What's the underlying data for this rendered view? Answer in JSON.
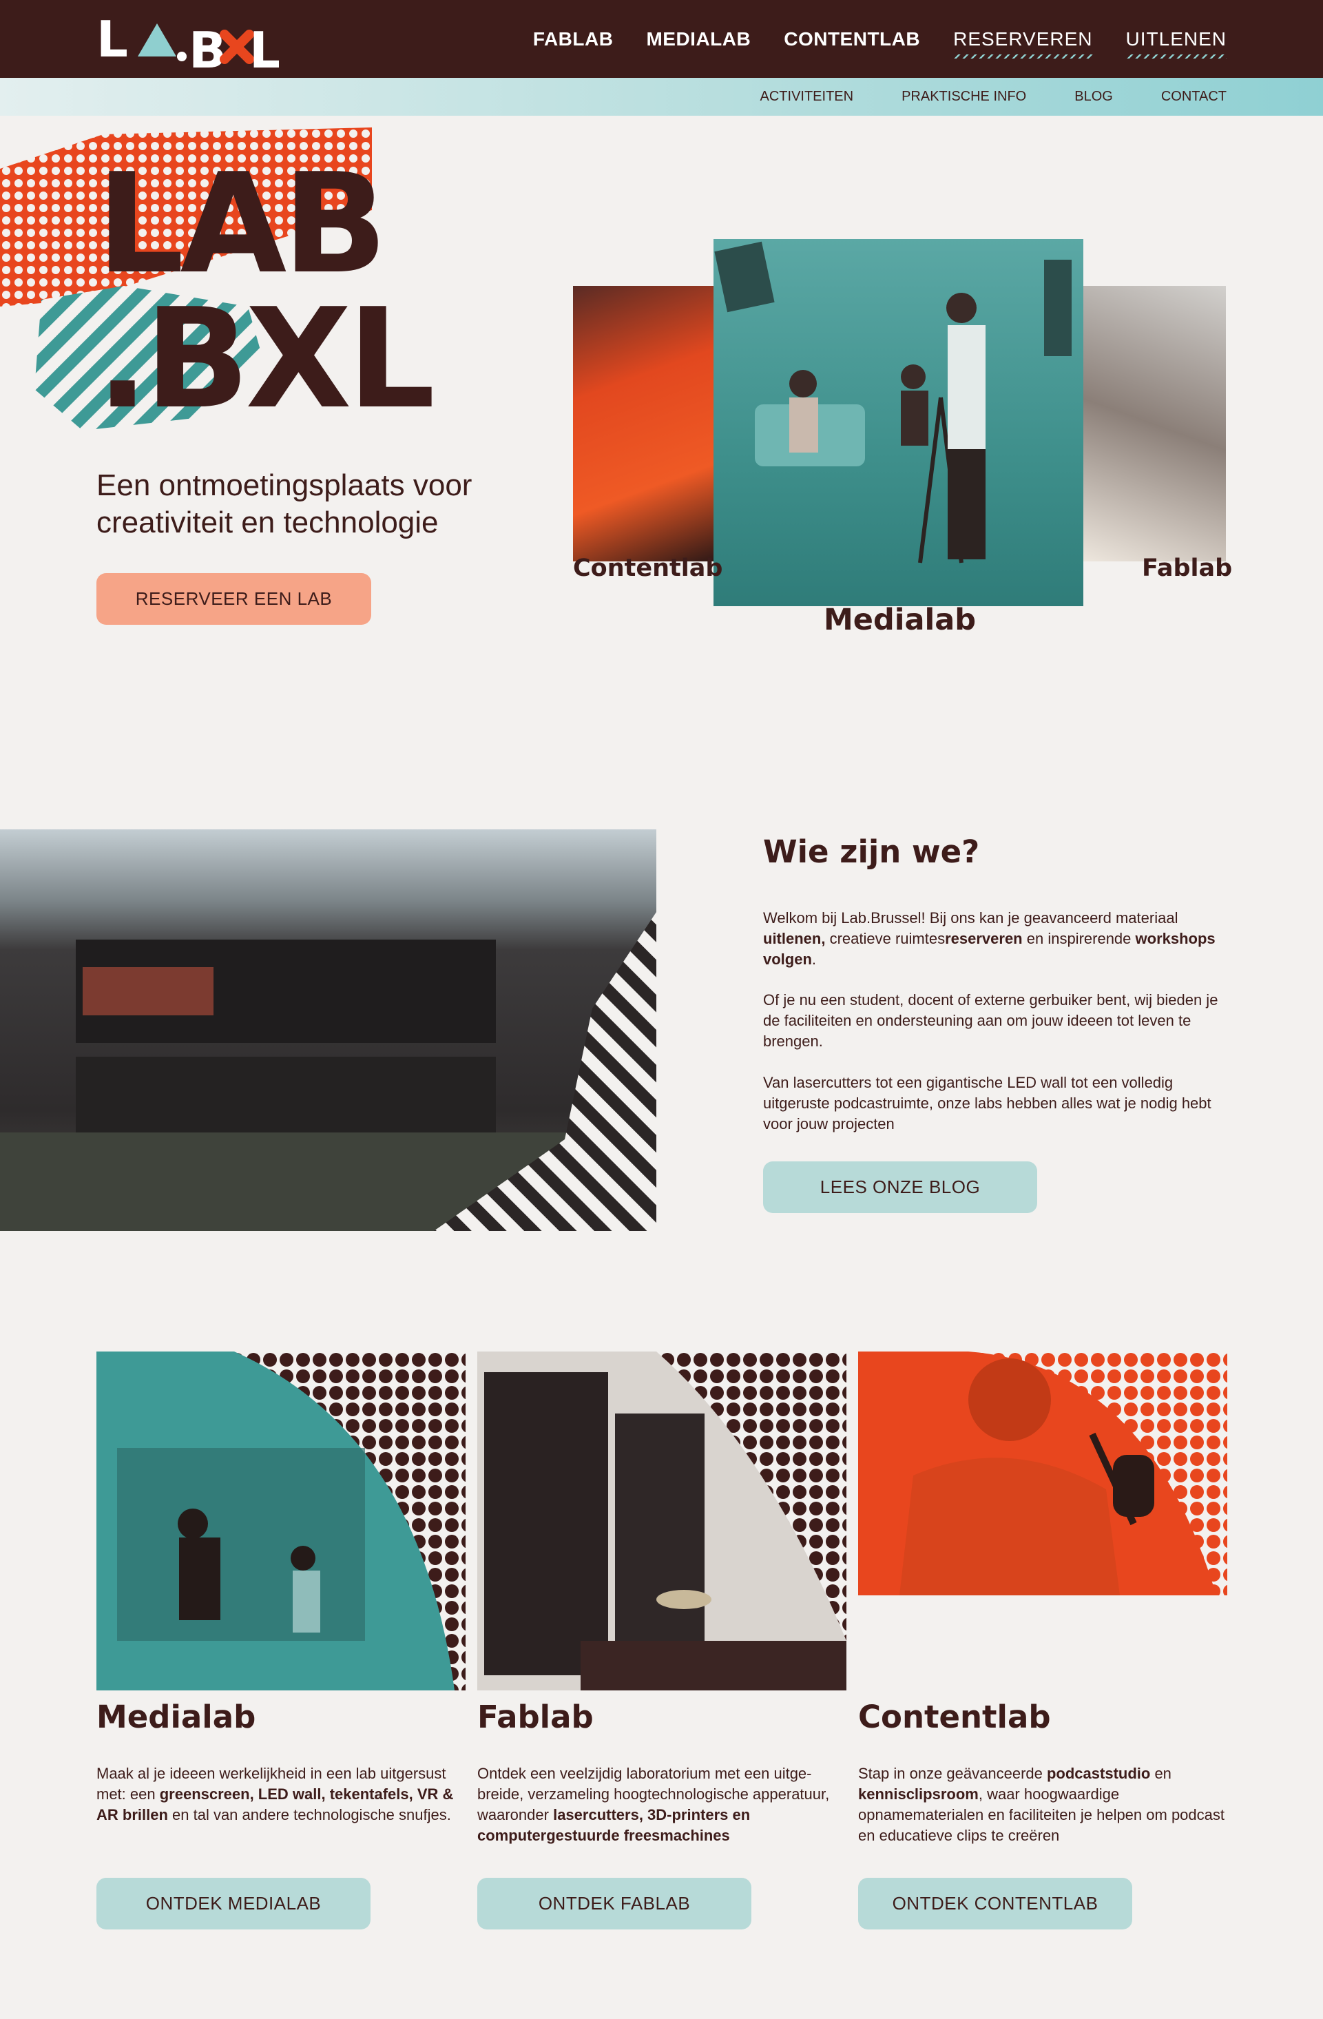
{
  "header": {
    "logo_text": "LAB.BXL",
    "nav": [
      "FABLAB",
      "MEDIALAB",
      "CONTENTLAB",
      "RESERVEREN",
      "UITLENEN"
    ],
    "subnav": [
      "ACTIVITEITEN",
      "PRAKTISCHE INFO",
      "BLOG",
      "CONTACT"
    ]
  },
  "hero": {
    "title_line1": "LAB",
    "title_line2": ".BXL",
    "subtitle": "Een ontmoetingsplaats voor creativiteit en technologie",
    "button": "RESERVEER EEN LAB",
    "captions": {
      "contentlab": "Contentlab",
      "medialab": "Medialab",
      "fablab": "Fablab"
    }
  },
  "about": {
    "heading": "Wie zijn we?",
    "p1_a": "Welkom bij Lab.Brussel! Bij ons kan je geavanceerd materiaal ",
    "p1_b": "uitlenen,",
    "p1_c": " creatieve ruimtes",
    "p1_d": "reserveren",
    "p1_e": "  en inspirerende ",
    "p1_f": "workshops volgen",
    "p1_g": ".",
    "p2": "Of je nu een student, docent of externe gerbuiker bent, wij bieden je de faciliteiten en ondersteuning aan om jouw ideeen tot leven te brengen.",
    "p3": "Van lasercutters tot een gigantische LED wall tot een volledig uitgeruste podcastruimte, onze labs hebben alles wat je nodig hebt voor jouw projecten",
    "button": "LEES ONZE BLOG"
  },
  "labs": [
    {
      "title": "Medialab",
      "text_a": "Maak al je ideeen werkelijkheid in een lab uitgersust met: een  ",
      "text_b": "greenscreen, LED wall, tekentafels, VR  & AR brillen",
      "text_c": " en tal van andere technologische snufjes.",
      "button": "ONTDEK MEDIALAB"
    },
    {
      "title": "Fablab",
      "text_a": "Ontdek een veelzijdig laboratorium met een uitge-breide, verzameling hoogtechnologische apperatuur, waaronder ",
      "text_b": "lasercutters, 3D-printers en computergestuurde freesmachines",
      "text_c": "",
      "button": "ONTDEK FABLAB"
    },
    {
      "title": "Contentlab",
      "text_a": "Stap in onze geävanceerde ",
      "text_b": "podcaststudio",
      "text_c": " en ",
      "text_d": "kennisclipsroom",
      "text_e": ", waar hoogwaardige opnamematerialen en faciliteiten je helpen om podcast en educatieve clips te creëren",
      "button": "ONTDEK CONTENTLAB"
    }
  ],
  "colors": {
    "brown": "#3d1c1a",
    "orange": "#e8461e",
    "teal": "#3e9a96",
    "peach": "#f6a487",
    "light_teal": "#b7dad8",
    "background": "#f3f1ef"
  }
}
